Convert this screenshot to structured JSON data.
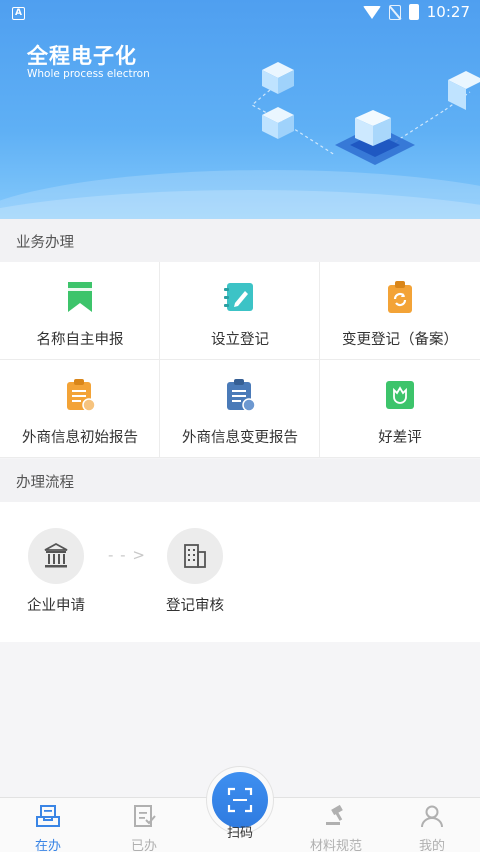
{
  "status_bar": {
    "time": "10:27",
    "app_badge": "A"
  },
  "banner": {
    "title": "全程电子化",
    "subtitle": "Whole process electron"
  },
  "services": {
    "section_title": "业务办理",
    "items": [
      {
        "label": "名称自主申报",
        "icon": "bookmark-icon",
        "color": "#3dc46b"
      },
      {
        "label": "设立登记",
        "icon": "notebook-pen-icon",
        "color": "#3cc3c6"
      },
      {
        "label": "变更登记（备案）",
        "icon": "clipboard-refresh-icon",
        "color": "#f3a337"
      },
      {
        "label": "外商信息初始报告",
        "icon": "clipboard-list-icon",
        "color": "#f3a337"
      },
      {
        "label": "外商信息变更报告",
        "icon": "clipboard-exchange-icon",
        "color": "#4a7ab8"
      },
      {
        "label": "好差评",
        "icon": "rating-flower-icon",
        "color": "#3dc46b"
      }
    ]
  },
  "process": {
    "section_title": "办理流程",
    "steps": [
      {
        "label": "企业申请",
        "icon": "bank-building-icon"
      },
      {
        "label": "登记审核",
        "icon": "office-building-icon"
      }
    ]
  },
  "bottom_nav": {
    "items": [
      {
        "label": "在办",
        "icon": "inbox-tray-icon",
        "active": true
      },
      {
        "label": "已办",
        "icon": "checked-document-icon",
        "active": false
      },
      {
        "label": "扫码",
        "icon": "scan-icon",
        "active": false
      },
      {
        "label": "材料规范",
        "icon": "gavel-icon",
        "active": false
      },
      {
        "label": "我的",
        "icon": "user-icon",
        "active": false
      }
    ],
    "active_color": "#3a85e5"
  }
}
